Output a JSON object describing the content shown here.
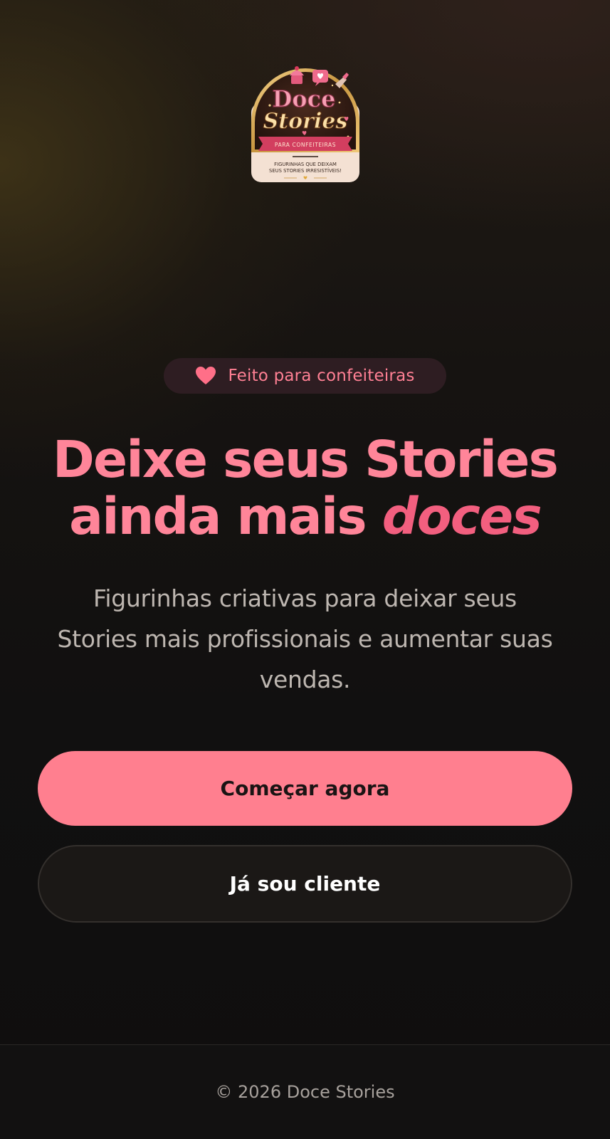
{
  "logo": {
    "alt": "Doce Stories",
    "line1": "Doce",
    "line2": "Stories",
    "ribbon": "PARA CONFEITEIRAS",
    "tagline1": "FIGURINHAS QUE DEIXAM",
    "tagline2": "SEUS STORIES IRRESISTÍVEIS!"
  },
  "badge": {
    "icon": "heart-icon",
    "text": "Feito para confeiteiras"
  },
  "hero": {
    "title_line1": "Deixe seus Stories",
    "title_line2_prefix": "ainda mais ",
    "title_accent": "doces",
    "subtitle": "Figurinhas criativas para deixar seus Stories mais profissionais e aumentar suas vendas."
  },
  "actions": {
    "primary_label": "Começar agora",
    "secondary_label": "Já sou cliente"
  },
  "footer": {
    "copyright": "© 2026 Doce Stories"
  },
  "colors": {
    "accent_pink": "#ff7f8f",
    "headline_pink": "#ff8599",
    "accent_dark_pink": "#f25f7f",
    "background": "#0f0e0d"
  }
}
